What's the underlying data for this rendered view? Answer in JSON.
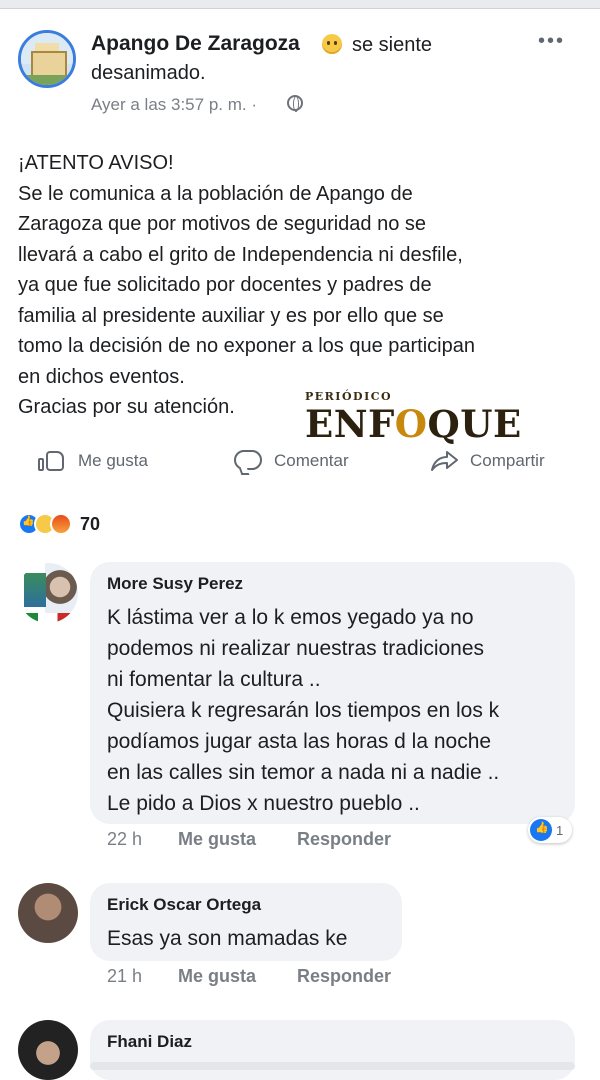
{
  "post": {
    "page_name": "Apango De Zaragoza",
    "feeling_line1": "se siente",
    "feeling_line2": "desanimado.",
    "timestamp": "Ayer a las 3:57 p. m. ·",
    "body_lines": [
      "¡ATENTO AVISO!",
      "Se le comunica a la población de Apango de",
      "Zaragoza que por motivos de seguridad no se",
      "llevará a cabo el grito de Independencia ni desfile,",
      "ya que fue solicitado por docentes y padres de",
      "familia al presidente auxiliar y es por ello que se",
      "tomo la decisión de no exponer a los que participan",
      "en dichos eventos.",
      "Gracias por su atención."
    ]
  },
  "watermark": {
    "small": "PERIÓDICO",
    "big_a": "ENF",
    "big_o": "O",
    "big_b": "QUE"
  },
  "actions": {
    "like": "Me gusta",
    "comment": "Comentar",
    "share": "Compartir"
  },
  "reactions": {
    "count": "70"
  },
  "comments": [
    {
      "name": "More Susy Perez",
      "lines": [
        "K lástima ver a lo k emos yegado ya no",
        "podemos ni realizar nuestras tradiciones",
        "ni fomentar la cultura ..",
        "Quisiera k regresarán los tiempos en los k",
        "podíamos jugar asta las horas d la noche",
        "en las calles sin temor a nada ni a nadie ..",
        "Le pido a Dios x nuestro pueblo .."
      ],
      "time": "22 h",
      "like": "Me gusta",
      "reply": "Responder",
      "reaction_count": "1"
    },
    {
      "name": "Erick Oscar Ortega",
      "lines": [
        "Esas ya son mamadas ke"
      ],
      "time": "21 h",
      "like": "Me gusta",
      "reply": "Responder"
    },
    {
      "name": "Fhani Diaz"
    }
  ]
}
